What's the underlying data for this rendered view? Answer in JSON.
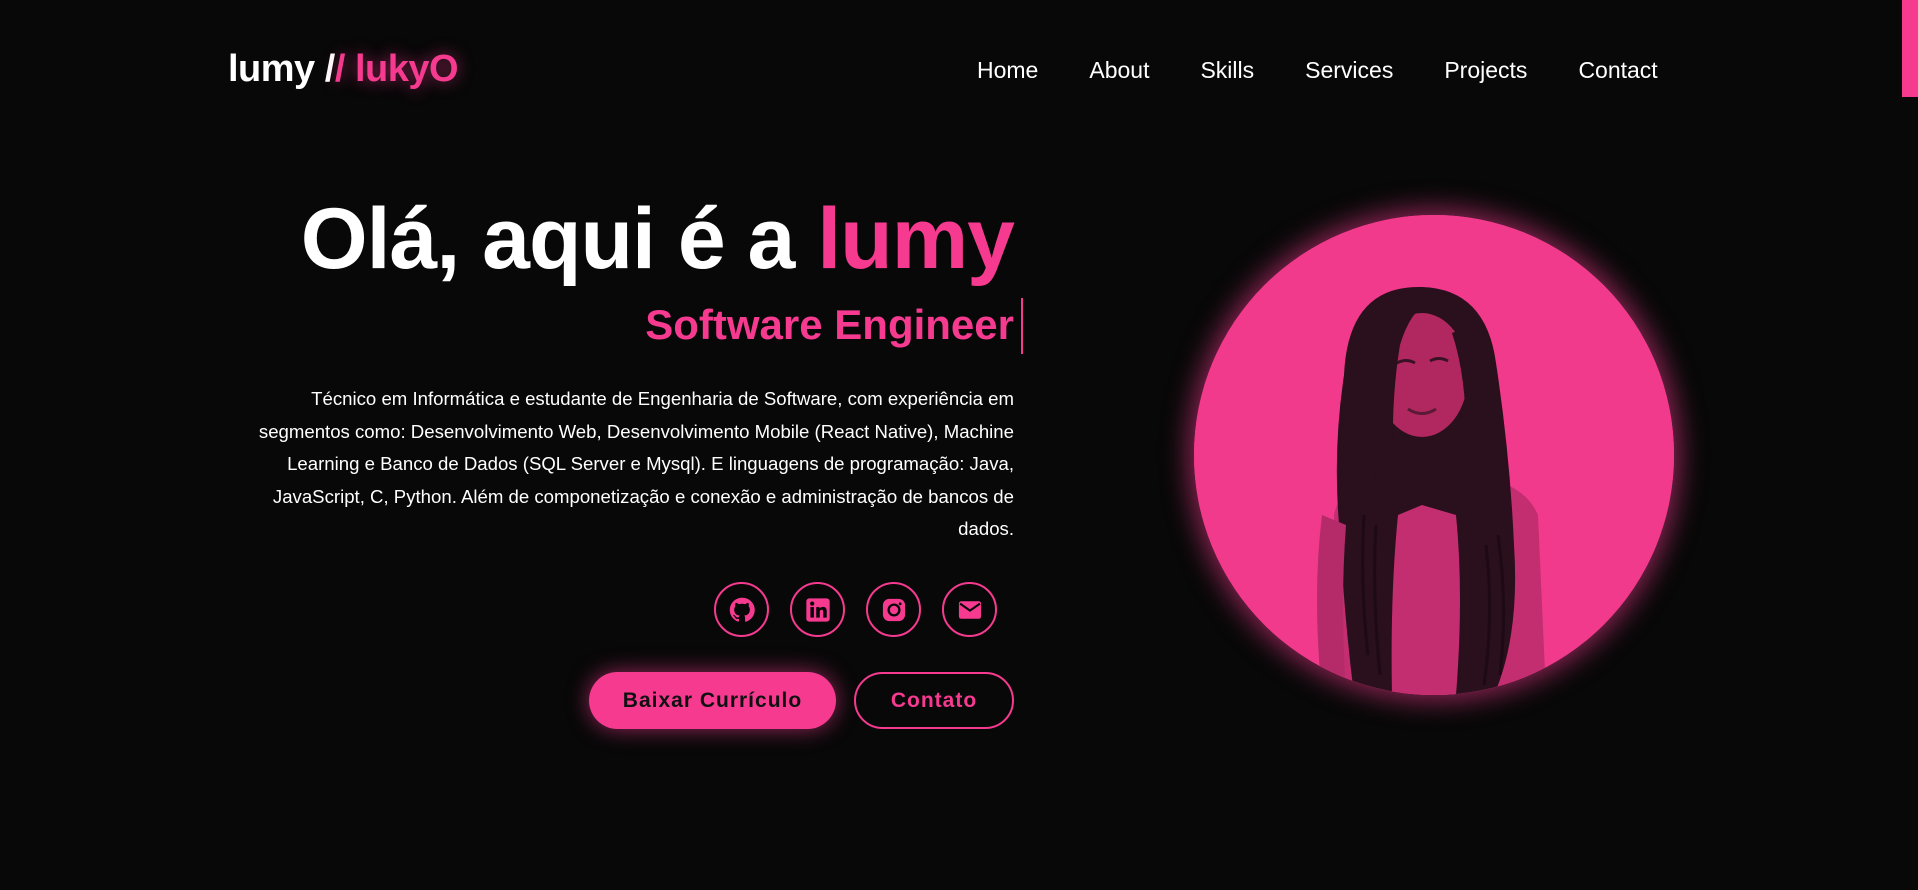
{
  "header": {
    "logo": {
      "first": "lumy",
      "separator": " /",
      "separator_accent": "/ ",
      "second": "lukyO"
    },
    "nav": [
      {
        "label": "Home"
      },
      {
        "label": "About"
      },
      {
        "label": "Skills"
      },
      {
        "label": "Services"
      },
      {
        "label": "Projects"
      },
      {
        "label": "Contact"
      }
    ]
  },
  "hero": {
    "title_prefix": "Olá, aqui é a ",
    "title_name": "lumy",
    "subtitle": "Software Engineer",
    "description": "Técnico em Informática e estudante de Engenharia de Software, com experiência em segmentos como: Desenvolvimento Web, Desenvolvimento Mobile (React Native), Machine Learning e Banco de Dados (SQL Server e Mysql). E linguagens de programação: Java, JavaScript, C, Python. Além de componetização e conexão e administração de bancos de dados.",
    "socials": [
      {
        "icon": "github-icon"
      },
      {
        "icon": "linkedin-icon"
      },
      {
        "icon": "instagram-icon"
      },
      {
        "icon": "mail-icon"
      }
    ],
    "buttons": {
      "download_cv": "Baixar Currículo",
      "contact": "Contato"
    },
    "profile_image": "profile-photo"
  },
  "colors": {
    "background": "#080808",
    "accent": "#f53a8f",
    "text": "#ffffff"
  }
}
